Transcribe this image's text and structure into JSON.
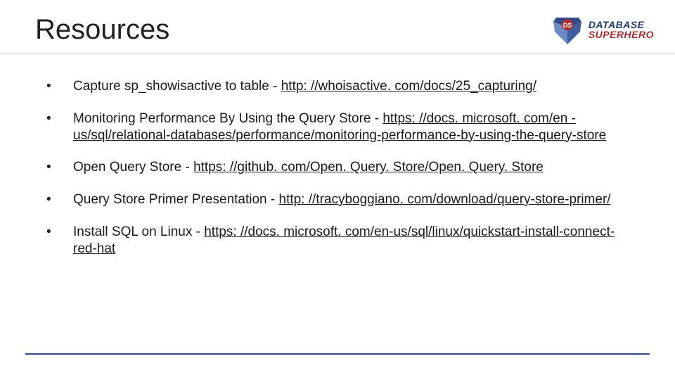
{
  "header": {
    "title": "Resources",
    "logo_line1": "DATABASE",
    "logo_line2": "SUPERHERO"
  },
  "bullets": [
    {
      "text": "Capture sp_showisactive to table - ",
      "link": "http: //whoisactive. com/docs/25_capturing/"
    },
    {
      "text": "Monitoring Performance By Using the Query Store - ",
      "link": "https: //docs. microsoft. com/en -us/sql/relational-databases/performance/monitoring-performance-by-using-the-query-store"
    },
    {
      "text": "Open Query Store - ",
      "link": "https: //github. com/Open. Query. Store/Open. Query. Store"
    },
    {
      "text": "Query Store Primer Presentation - ",
      "link": "http: //tracyboggiano. com/download/query-store-primer/"
    },
    {
      "text": "Install SQL on Linux - ",
      "link": "https: //docs. microsoft. com/en-us/sql/linux/quickstart-install-connect-red-hat"
    }
  ]
}
